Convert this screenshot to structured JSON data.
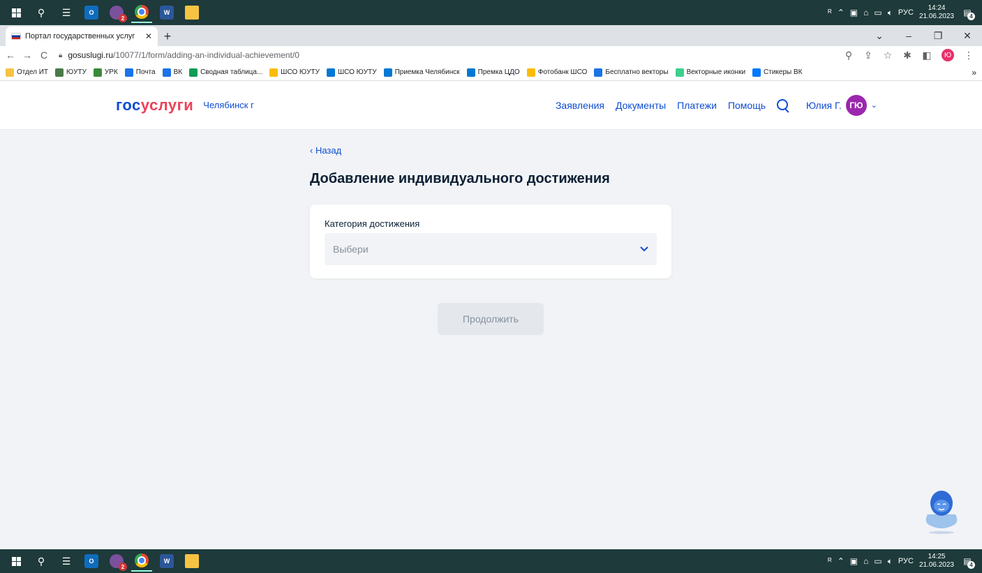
{
  "taskbar_top": {
    "tray": {
      "lang": "РУС",
      "time": "14:24",
      "date": "21.06.2023",
      "notifications": "4"
    },
    "viber_badge": "2"
  },
  "taskbar_bottom": {
    "tray": {
      "lang": "РУС",
      "time": "14:25",
      "date": "21.06.2023",
      "notifications": "4"
    },
    "viber_badge": "2"
  },
  "browser": {
    "tab_title": "Портал государственных услуг",
    "url_host": "gosuslugi.ru",
    "url_path": "/10077/1/form/adding-an-individual-achievement/0",
    "profile_initial": "Ю",
    "bookmarks": [
      {
        "label": "Отдел ИТ",
        "color": "#f6c343"
      },
      {
        "label": "ЮУТУ",
        "color": "#4a7a4a"
      },
      {
        "label": "УРК",
        "color": "#3a8a3a"
      },
      {
        "label": "Почта",
        "color": "#1a73e8"
      },
      {
        "label": "ВК",
        "color": "#1a73e8"
      },
      {
        "label": "Сводная таблица...",
        "color": "#0f9d58"
      },
      {
        "label": "ШСО ЮУТУ",
        "color": "#fbbc05"
      },
      {
        "label": "ШСО ЮУТУ",
        "color": "#0078d4"
      },
      {
        "label": "Приемка Челябинск",
        "color": "#0078d4"
      },
      {
        "label": "Премка ЦДО",
        "color": "#0078d4"
      },
      {
        "label": "Фотобанк ШСО",
        "color": "#fbbc05"
      },
      {
        "label": "Бесплатно векторы",
        "color": "#1a73e8"
      },
      {
        "label": "Векторные иконки",
        "color": "#3ecf8e"
      },
      {
        "label": "Стикеры ВК",
        "color": "#0077ff"
      }
    ],
    "bookmarks_more": "»"
  },
  "site": {
    "logo_gos": "гос",
    "logo_uslugi": "услуги",
    "region": "Челябинск г",
    "nav": [
      "Заявления",
      "Документы",
      "Платежи",
      "Помощь"
    ],
    "user_name": "Юлия Г.",
    "user_initials": "ГЮ"
  },
  "form": {
    "back_label": "Назад",
    "title": "Добавление индивидуального достижения",
    "field_label": "Категория достижения",
    "select_placeholder": "Выбери",
    "continue_label": "Продолжить"
  }
}
